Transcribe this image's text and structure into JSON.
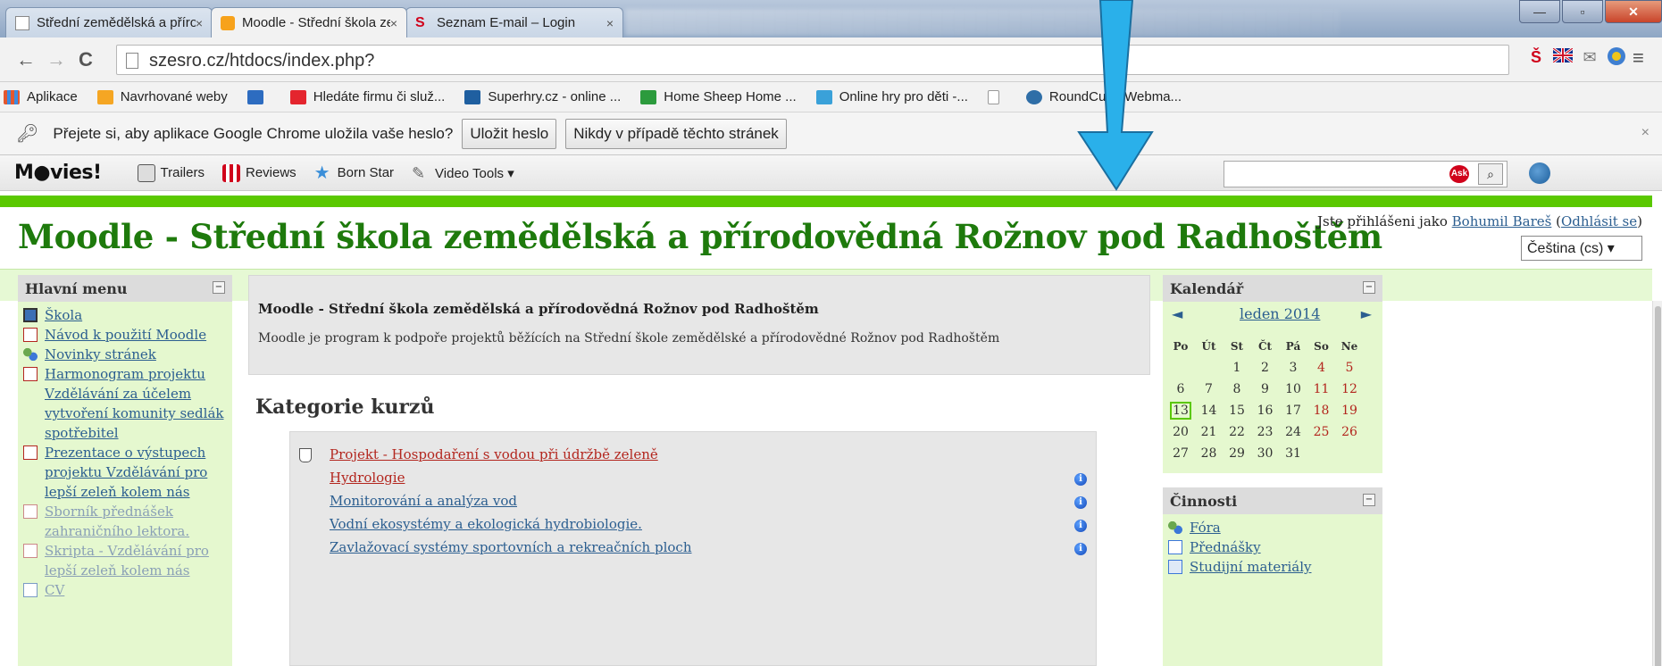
{
  "tabs": [
    {
      "title": "Střední zemědělská a příro",
      "close": "×"
    },
    {
      "title": "Moodle - Střední škola zer",
      "close": "×"
    },
    {
      "title": "Seznam E-mail – Login",
      "close": "×"
    }
  ],
  "window_buttons": {
    "minimize": "—",
    "maximize": "▫",
    "close": "✕"
  },
  "toolbar": {
    "back": "←",
    "forward": "→",
    "reload": "C",
    "url": "szesro.cz/htdocs/index.php?",
    "menu": "≡"
  },
  "bookmarks": [
    {
      "label": "Aplikace",
      "icon": "apps-icon",
      "color": "#e4572e"
    },
    {
      "label": "Navrhované weby",
      "icon": "suggested-icon",
      "color": "#f5a623"
    },
    {
      "label": "",
      "icon": "bw-icon",
      "color": "#2d6cc0"
    },
    {
      "label": "Hledáte firmu či služ...",
      "icon": "firmy-icon",
      "color": "#e4252e"
    },
    {
      "label": "Superhry.cz - online ...",
      "icon": "superhry-icon",
      "color": "#1f5fa0"
    },
    {
      "label": "Home Sheep Home ...",
      "icon": "sheep-icon",
      "color": "#2c9b3d"
    },
    {
      "label": "Online hry pro děti -...",
      "icon": "kids-icon",
      "color": "#3aa1d9"
    },
    {
      "label": "",
      "icon": "page-icon",
      "color": "#ffffff"
    },
    {
      "label": "RoundCube Webma...",
      "icon": "roundcube-icon",
      "color": "#2f6ea7"
    }
  ],
  "infobar": {
    "text": "Přejete si, aby aplikace Google Chrome uložila vaše heslo?",
    "save": "Uložit heslo",
    "never": "Nikdy v případě těchto stránek",
    "close": "×"
  },
  "movies_toolbar": {
    "logo": "M●vies!",
    "items": [
      "Trailers",
      "Reviews",
      "Born Star",
      "Video Tools ▾"
    ],
    "ask": "Ask",
    "search_glyph": "⌕"
  },
  "page": {
    "title": "Moodle - Střední škola zemědělská a přírodovědná Rožnov pod Radhoštěm",
    "login_prefix": "Jste přihlášeni jako ",
    "login_user": "Bohumil Bareš",
    "login_open": " (",
    "logout": "Odhlásit se",
    "login_close": ")",
    "language": "Čeština (cs) ▾"
  },
  "main_menu": {
    "title": "Hlavní menu",
    "toggle": "−",
    "items": [
      {
        "label": "Škola",
        "icon": "monitor-icon",
        "dim": false
      },
      {
        "label": "Návod k použití Moodle",
        "icon": "pdf-icon",
        "dim": false
      },
      {
        "label": "Novinky stránek",
        "icon": "forum-icon",
        "dim": false
      },
      {
        "label": "Harmonogram projektu Vzdělávání za účelem vytvoření komunity sedlák spotřebitel",
        "icon": "pdf-icon",
        "dim": false
      },
      {
        "label": "Prezentace o výstupech projektu Vzdělávání pro lepší zeleň kolem nás",
        "icon": "pdf-icon",
        "dim": false
      },
      {
        "label": "Sborník přednášek zahraničního lektora.",
        "icon": "pdf-icon",
        "dim": true
      },
      {
        "label": "Skripta - Vzdělávání pro lepší zeleň kolem nás",
        "icon": "pdf-icon",
        "dim": true
      },
      {
        "label": "CV",
        "icon": "folder-icon",
        "dim": true
      }
    ]
  },
  "center": {
    "heading": "Moodle - Střední škola zemědělská a přírodovědná Rožnov pod Radhoštěm",
    "description": "Moodle je program k podpoře projektů běžících na Střední škole zemědělské a přírodovědné Rožnov pod Radhoštěm",
    "categories_title": "Kategorie kurzů",
    "category": "Projekt - Hospodaření s vodou při údržbě zeleně",
    "courses": [
      {
        "label": "Hydrologie",
        "red": true
      },
      {
        "label": "Monitorování a analýza vod",
        "red": false
      },
      {
        "label": "Vodní ekosystémy a ekologická hydrobiologie.",
        "red": false
      },
      {
        "label": "Zavlažovací systémy sportovních a rekreačních ploch",
        "red": false
      }
    ],
    "info_glyph": "i"
  },
  "calendar": {
    "title": "Kalendář",
    "toggle": "−",
    "prev": "◄",
    "month": "leden 2014",
    "next": "►",
    "weekdays": [
      "Po",
      "Út",
      "St",
      "Čt",
      "Pá",
      "So",
      "Ne"
    ],
    "weeks": [
      [
        "",
        "",
        "1",
        "2",
        "3",
        "4",
        "5"
      ],
      [
        "6",
        "7",
        "8",
        "9",
        "10",
        "11",
        "12"
      ],
      [
        "13",
        "14",
        "15",
        "16",
        "17",
        "18",
        "19"
      ],
      [
        "20",
        "21",
        "22",
        "23",
        "24",
        "25",
        "26"
      ],
      [
        "27",
        "28",
        "29",
        "30",
        "31",
        "",
        ""
      ]
    ],
    "today": "13"
  },
  "activities": {
    "title": "Činnosti",
    "toggle": "−",
    "items": [
      {
        "label": "Fóra",
        "icon": "forum-icon"
      },
      {
        "label": "Přednášky",
        "icon": "lecture-icon"
      },
      {
        "label": "Studijní materiály",
        "icon": "material-icon"
      }
    ]
  },
  "colors": {
    "moodle_green": "#1e7a0c",
    "accent_line": "#5ac800",
    "block_bg": "#e5f8cf",
    "link": "#2b5e90",
    "weekend": "#b3261e"
  }
}
